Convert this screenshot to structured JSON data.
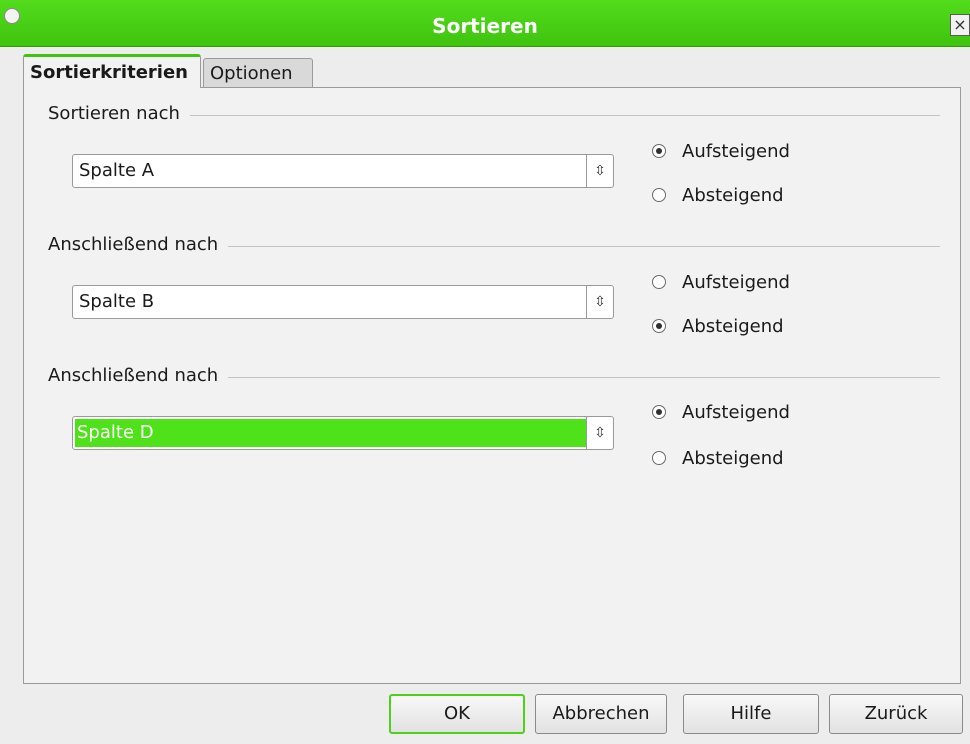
{
  "window": {
    "title": "Sortieren",
    "close_glyph": "×"
  },
  "tabs": {
    "active": "Sortierkriterien",
    "inactive": "Optionen"
  },
  "sections": [
    {
      "label": "Sortieren nach",
      "value": "Spalte A",
      "selected": false,
      "asc_label": "Aufsteigend",
      "desc_label": "Absteigend",
      "asc_checked": true
    },
    {
      "label": "Anschließend nach",
      "value": "Spalte B",
      "selected": false,
      "asc_label": "Aufsteigend",
      "desc_label": "Absteigend",
      "asc_checked": false
    },
    {
      "label": "Anschließend nach",
      "value": "Spalte D",
      "selected": true,
      "asc_label": "Aufsteigend",
      "desc_label": "Absteigend",
      "asc_checked": true
    }
  ],
  "buttons": {
    "ok": "OK",
    "cancel": "Abbrechen",
    "help": "Hilfe",
    "back": "Zurück"
  },
  "colors": {
    "accent": "#3fc40f",
    "selection": "#4fe11a"
  }
}
